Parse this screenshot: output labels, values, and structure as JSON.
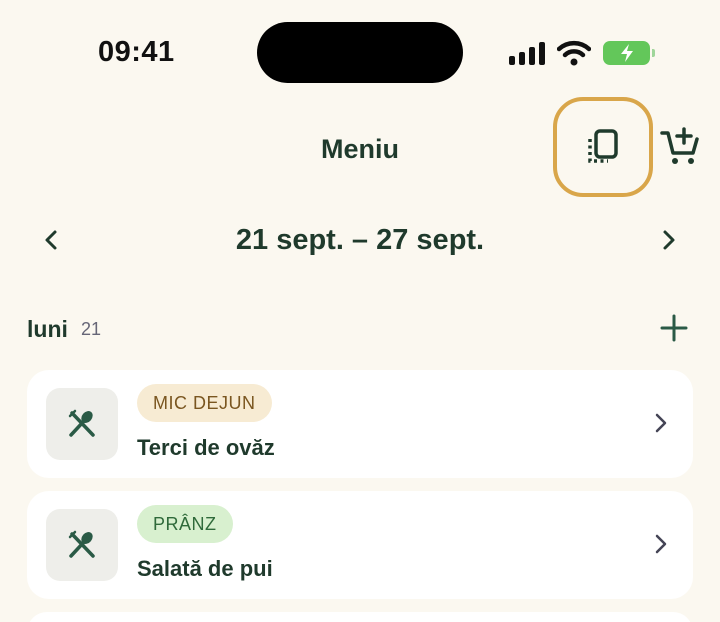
{
  "status_bar": {
    "time": "09:41"
  },
  "header": {
    "title": "Meniu"
  },
  "week": {
    "range": "21 sept. – 27 sept."
  },
  "day": {
    "name": "luni",
    "number": "21"
  },
  "meals": [
    {
      "type": "MIC DEJUN",
      "name": "Terci de ovăz"
    },
    {
      "type": "PRÂNZ",
      "name": "Salată de pui"
    }
  ],
  "colors": {
    "accent": "#d9a64a",
    "text": "#1f3a2c",
    "background": "#fbf8f0"
  },
  "icons": [
    "copy-icon",
    "cart-add-icon",
    "chevron-left-icon",
    "chevron-right-icon",
    "plus-icon",
    "utensils-icon"
  ]
}
